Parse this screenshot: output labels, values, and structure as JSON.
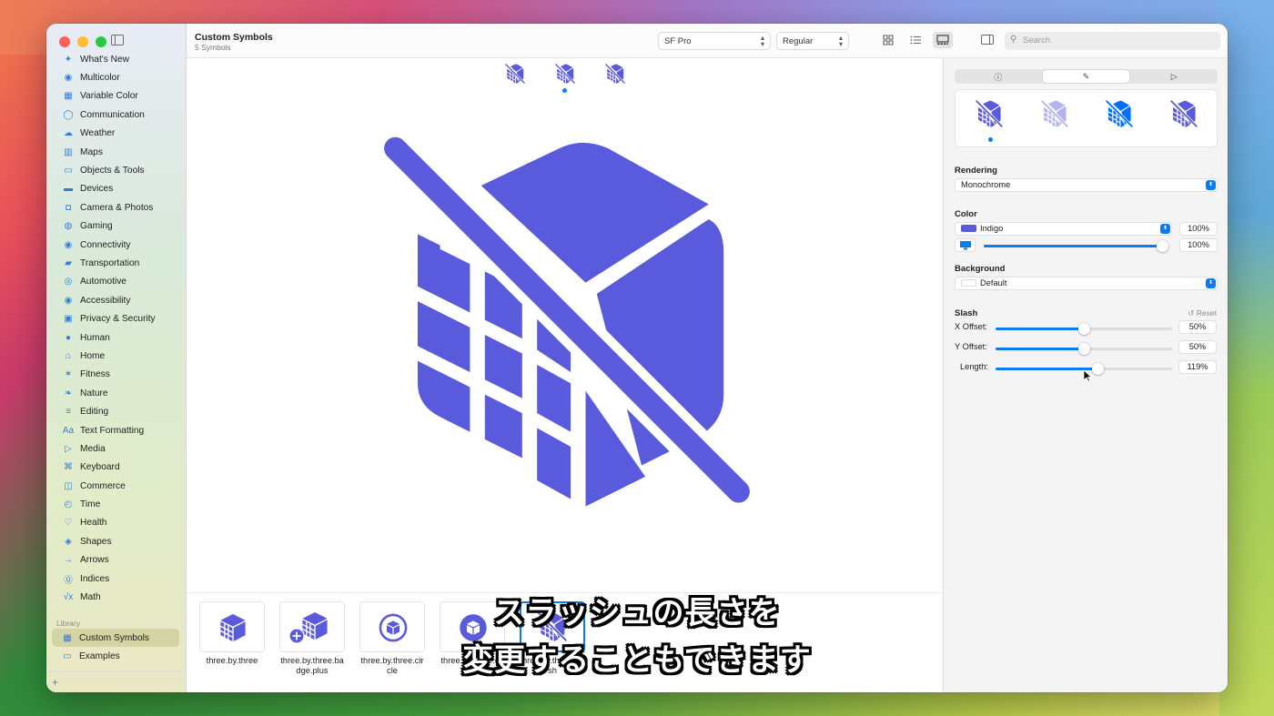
{
  "window": {
    "title": "Custom Symbols",
    "subtitle": "5 Symbols"
  },
  "sidebar": {
    "categories": [
      {
        "label": "What's New",
        "icon": "sparkle-icon",
        "glyph": "✦"
      },
      {
        "label": "Multicolor",
        "icon": "paintpalette-icon",
        "glyph": "◉"
      },
      {
        "label": "Variable Color",
        "icon": "variable-color-icon",
        "glyph": "▦"
      },
      {
        "label": "Communication",
        "icon": "message-icon",
        "glyph": "◯"
      },
      {
        "label": "Weather",
        "icon": "cloud-sun-icon",
        "glyph": "☁"
      },
      {
        "label": "Maps",
        "icon": "map-icon",
        "glyph": "▥"
      },
      {
        "label": "Objects & Tools",
        "icon": "folder-icon",
        "glyph": "▭"
      },
      {
        "label": "Devices",
        "icon": "display-icon",
        "glyph": "▬"
      },
      {
        "label": "Camera & Photos",
        "icon": "camera-icon",
        "glyph": "◘"
      },
      {
        "label": "Gaming",
        "icon": "gamecontroller-icon",
        "glyph": "◍"
      },
      {
        "label": "Connectivity",
        "icon": "antenna-icon",
        "glyph": "◉"
      },
      {
        "label": "Transportation",
        "icon": "car-icon",
        "glyph": "▰"
      },
      {
        "label": "Automotive",
        "icon": "steering-wheel-icon",
        "glyph": "◎"
      },
      {
        "label": "Accessibility",
        "icon": "accessibility-icon",
        "glyph": "◉"
      },
      {
        "label": "Privacy & Security",
        "icon": "lock-icon",
        "glyph": "▣"
      },
      {
        "label": "Human",
        "icon": "person-icon",
        "glyph": "●"
      },
      {
        "label": "Home",
        "icon": "house-icon",
        "glyph": "⌂"
      },
      {
        "label": "Fitness",
        "icon": "figure-run-icon",
        "glyph": "✶"
      },
      {
        "label": "Nature",
        "icon": "leaf-icon",
        "glyph": "❧"
      },
      {
        "label": "Editing",
        "icon": "slider-icon",
        "glyph": "≡"
      },
      {
        "label": "Text Formatting",
        "icon": "textformat-icon",
        "glyph": "Aa"
      },
      {
        "label": "Media",
        "icon": "playpause-icon",
        "glyph": "▷"
      },
      {
        "label": "Keyboard",
        "icon": "command-icon",
        "glyph": "⌘"
      },
      {
        "label": "Commerce",
        "icon": "cart-icon",
        "glyph": "◫"
      },
      {
        "label": "Time",
        "icon": "clock-icon",
        "glyph": "◴"
      },
      {
        "label": "Health",
        "icon": "heart-icon",
        "glyph": "♡"
      },
      {
        "label": "Shapes",
        "icon": "shapes-icon",
        "glyph": "◈"
      },
      {
        "label": "Arrows",
        "icon": "arrow-right-icon",
        "glyph": "→"
      },
      {
        "label": "Indices",
        "icon": "index-circle-icon",
        "glyph": "⓪"
      },
      {
        "label": "Math",
        "icon": "sqrt-icon",
        "glyph": "√x"
      }
    ],
    "library_header": "Library",
    "library_items": [
      {
        "label": "Custom Symbols",
        "icon": "grid-icon",
        "glyph": "▦",
        "selected": true
      },
      {
        "label": "Examples",
        "icon": "folder-icon",
        "glyph": "▭",
        "selected": false
      }
    ],
    "add_label": "+"
  },
  "toolbar": {
    "font": "SF Pro",
    "weight": "Regular",
    "search_placeholder": "Search"
  },
  "tiles": [
    {
      "label": "three.by.three"
    },
    {
      "label": "three.by.three.badge.plus"
    },
    {
      "label": "three.by.three.circle"
    },
    {
      "label": "three.by.three.circle.fill"
    },
    {
      "label": "three.by.three.slash"
    }
  ],
  "inspector": {
    "rendering_label": "Rendering",
    "rendering_value": "Monochrome",
    "color_label": "Color",
    "color_value": "Indigo",
    "color_pct": "100%",
    "opacity_pct": "100%",
    "background_label": "Background",
    "background_value": "Default",
    "slash_label": "Slash",
    "reset_label": "Reset",
    "x_offset_label": "X Offset:",
    "x_offset_value": "50%",
    "y_offset_label": "Y Offset:",
    "y_offset_value": "50%",
    "length_label": "Length:",
    "length_value": "119%"
  },
  "colors": {
    "symbol": "#5a5adc",
    "accent": "#0a7cf0"
  },
  "subtitle": {
    "line1": "スラッシュの長さを",
    "line2": "変更することもできます"
  }
}
